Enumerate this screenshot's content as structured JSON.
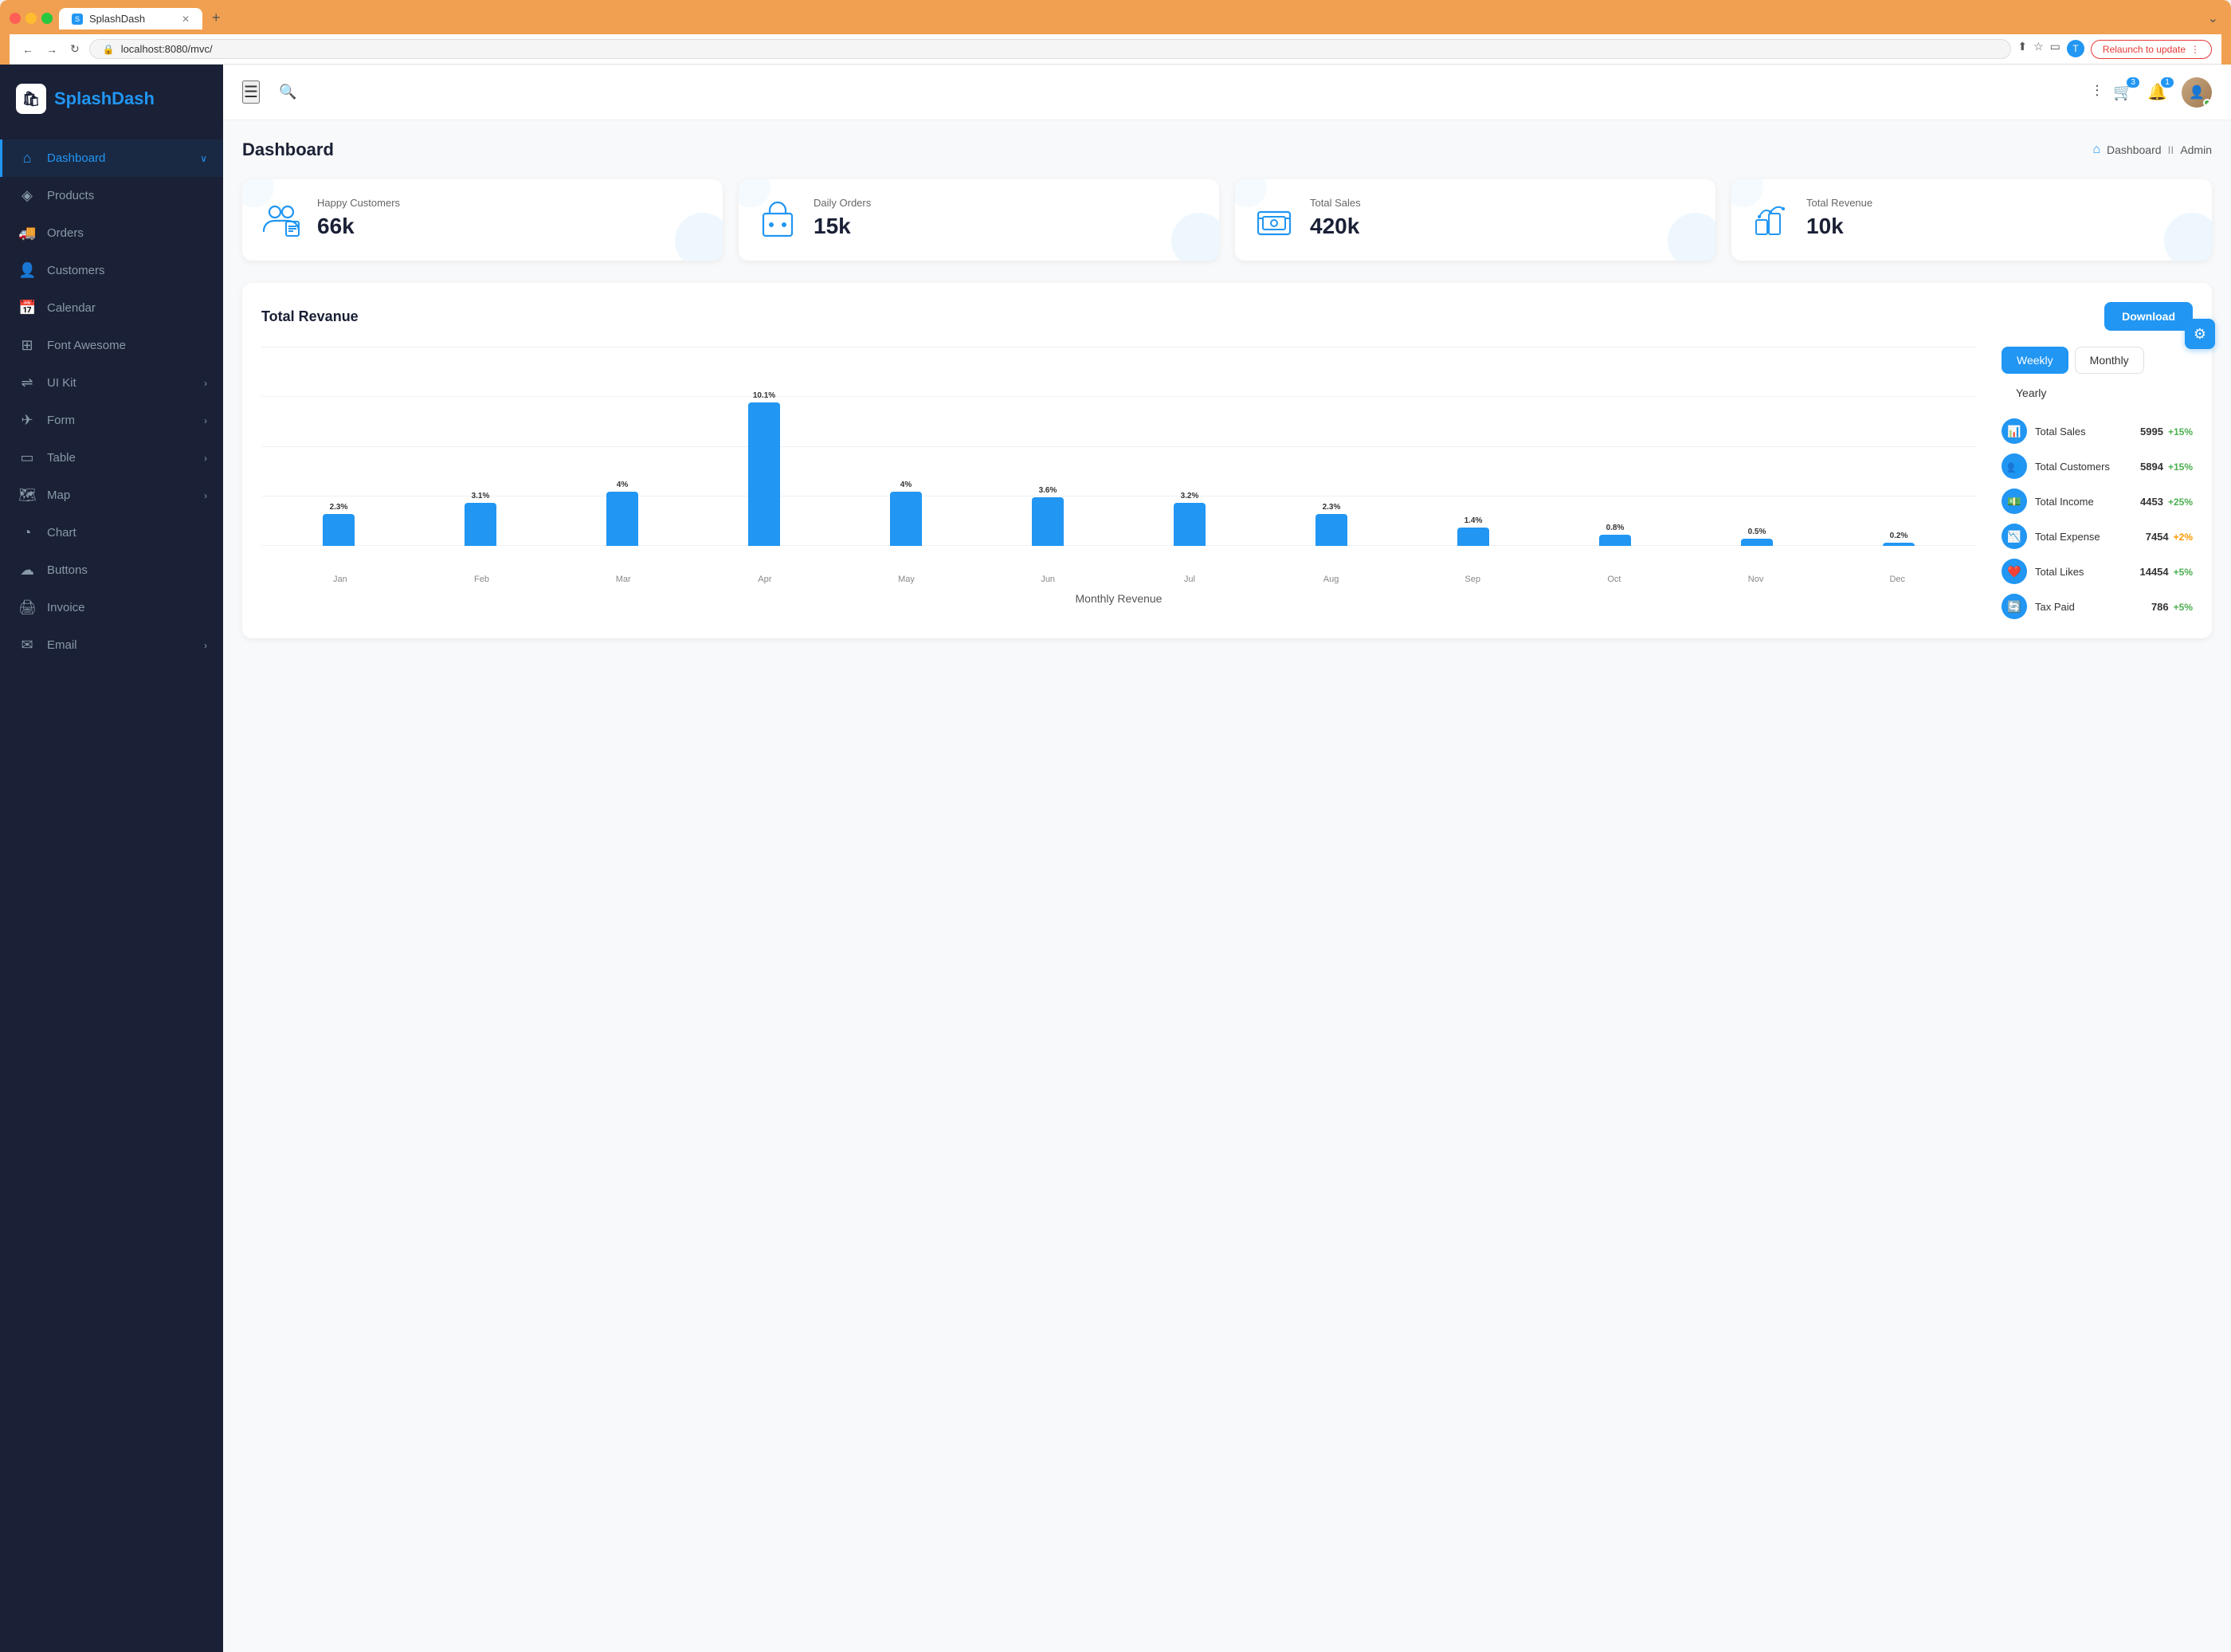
{
  "browser": {
    "tab_title": "SplashDash",
    "url": "localhost:8080/mvc/",
    "relaunch_label": "Relaunch to update",
    "new_tab_icon": "+",
    "chevron": "⌄"
  },
  "sidebar": {
    "logo_text_plain": "Splash",
    "logo_text_bold": "Dash",
    "nav_items": [
      {
        "id": "dashboard",
        "label": "Dashboard",
        "icon": "⌂",
        "active": true,
        "has_arrow": true
      },
      {
        "id": "products",
        "label": "Products",
        "icon": "◈",
        "active": false,
        "has_arrow": false
      },
      {
        "id": "orders",
        "label": "Orders",
        "icon": "🚚",
        "active": false,
        "has_arrow": false
      },
      {
        "id": "customers",
        "label": "Customers",
        "icon": "👤",
        "active": false,
        "has_arrow": false
      },
      {
        "id": "calendar",
        "label": "Calendar",
        "icon": "📅",
        "active": false,
        "has_arrow": false
      },
      {
        "id": "font-awesome",
        "label": "Font Awesome",
        "icon": "⊞",
        "active": false,
        "has_arrow": false
      },
      {
        "id": "ui-kit",
        "label": "UI Kit",
        "icon": "⇌",
        "active": false,
        "has_arrow": true
      },
      {
        "id": "form",
        "label": "Form",
        "icon": "✈",
        "active": false,
        "has_arrow": true
      },
      {
        "id": "table",
        "label": "Table",
        "icon": "▭",
        "active": false,
        "has_arrow": true
      },
      {
        "id": "map",
        "label": "Map",
        "icon": "🗺",
        "active": false,
        "has_arrow": true
      },
      {
        "id": "chart",
        "label": "Chart",
        "icon": "◔",
        "active": false,
        "has_arrow": false
      },
      {
        "id": "buttons",
        "label": "Buttons",
        "icon": "☁",
        "active": false,
        "has_arrow": false
      },
      {
        "id": "invoice",
        "label": "Invoice",
        "icon": "🖨",
        "active": false,
        "has_arrow": false
      },
      {
        "id": "email",
        "label": "Email",
        "icon": "✉",
        "active": false,
        "has_arrow": true
      }
    ]
  },
  "header": {
    "cart_badge": "3",
    "notification_badge": "1"
  },
  "page": {
    "title": "Dashboard",
    "breadcrumb_home": "Dashboard",
    "breadcrumb_sep": "II",
    "breadcrumb_page": "Admin"
  },
  "stats": [
    {
      "id": "happy-customers",
      "label": "Happy Customers",
      "value": "66k",
      "icon": "👥"
    },
    {
      "id": "daily-orders",
      "label": "Daily Orders",
      "value": "15k",
      "icon": "🏠"
    },
    {
      "id": "total-sales",
      "label": "Total Sales",
      "value": "420k",
      "icon": "💻"
    },
    {
      "id": "total-revenue",
      "label": "Total Revenue",
      "value": "10k",
      "icon": "💰"
    }
  ],
  "revenue": {
    "title": "Total Revanue",
    "download_label": "Download",
    "chart_label": "Monthly Revenue",
    "periods": [
      "Weekly",
      "Monthly",
      "Yearly"
    ],
    "active_period": "Weekly",
    "months": [
      "Jan",
      "Feb",
      "Mar",
      "Apr",
      "May",
      "Jun",
      "Jul",
      "Aug",
      "Sep",
      "Oct",
      "Nov",
      "Dec"
    ],
    "bar_data": [
      {
        "month": "Jan",
        "value": 2.3,
        "height_pct": 22
      },
      {
        "month": "Feb",
        "value": 3.1,
        "height_pct": 30
      },
      {
        "month": "Mar",
        "value": 4.0,
        "height_pct": 38
      },
      {
        "month": "Apr",
        "value": 10.1,
        "height_pct": 100
      },
      {
        "month": "May",
        "value": 4.0,
        "height_pct": 38
      },
      {
        "month": "Jun",
        "value": 3.6,
        "height_pct": 34
      },
      {
        "month": "Jul",
        "value": 3.2,
        "height_pct": 30
      },
      {
        "month": "Aug",
        "value": 2.3,
        "height_pct": 22
      },
      {
        "month": "Sep",
        "value": 1.4,
        "height_pct": 13
      },
      {
        "month": "Oct",
        "value": 0.8,
        "height_pct": 8
      },
      {
        "month": "Nov",
        "value": 0.5,
        "height_pct": 5
      },
      {
        "month": "Dec",
        "value": 0.2,
        "height_pct": 2
      }
    ],
    "stat_items": [
      {
        "id": "total-sales",
        "name": "Total Sales",
        "value": "5995",
        "change": "+15%",
        "change_type": "positive"
      },
      {
        "id": "total-customers",
        "name": "Total Customers",
        "value": "5894",
        "change": "+15%",
        "change_type": "positive"
      },
      {
        "id": "total-income",
        "name": "Total Income",
        "value": "4453",
        "change": "+25%",
        "change_type": "positive"
      },
      {
        "id": "total-expense",
        "name": "Total Expense",
        "value": "7454",
        "change": "+2%",
        "change_type": "warning"
      },
      {
        "id": "total-likes",
        "name": "Total Likes",
        "value": "14454",
        "change": "+5%",
        "change_type": "positive"
      },
      {
        "id": "tax-paid",
        "name": "Tax Paid",
        "value": "786",
        "change": "+5%",
        "change_type": "positive"
      }
    ]
  }
}
